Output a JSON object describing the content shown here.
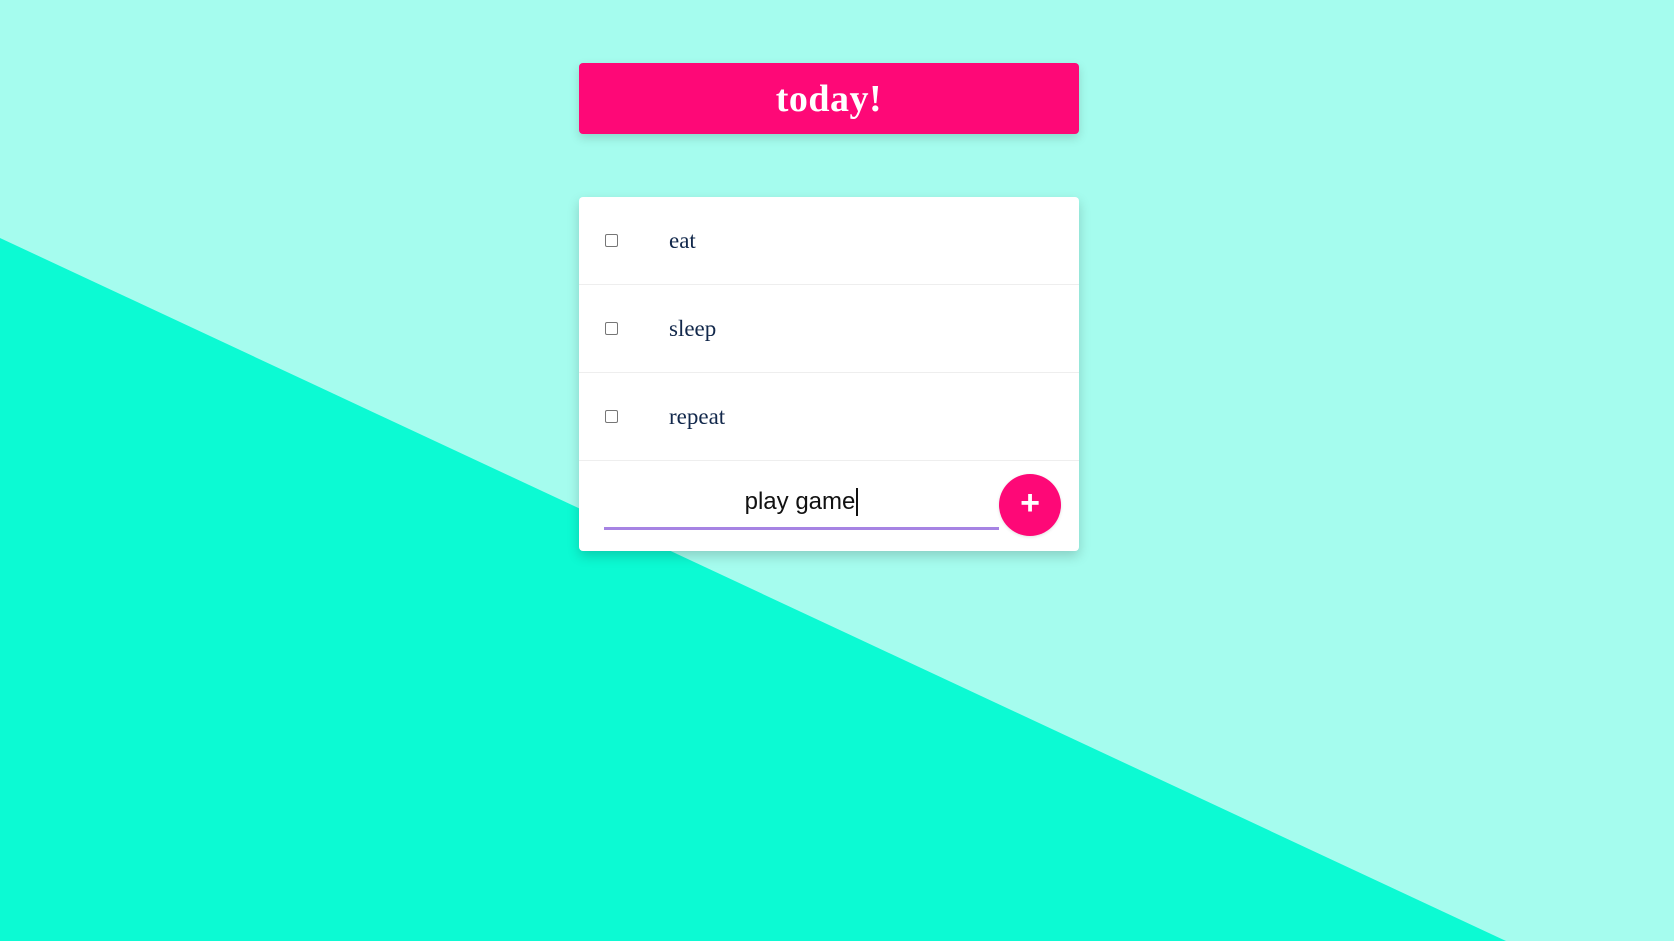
{
  "header": {
    "title": "today!"
  },
  "todos": [
    {
      "label": "eat",
      "checked": false
    },
    {
      "label": "sleep",
      "checked": false
    },
    {
      "label": "repeat",
      "checked": false
    }
  ],
  "new_item": {
    "value": "play game",
    "add_icon": "plus-icon"
  },
  "colors": {
    "background_light": "#a5fcee",
    "background_dark": "#0cfad3",
    "accent": "#fe0877",
    "input_underline": "#a683e3"
  }
}
